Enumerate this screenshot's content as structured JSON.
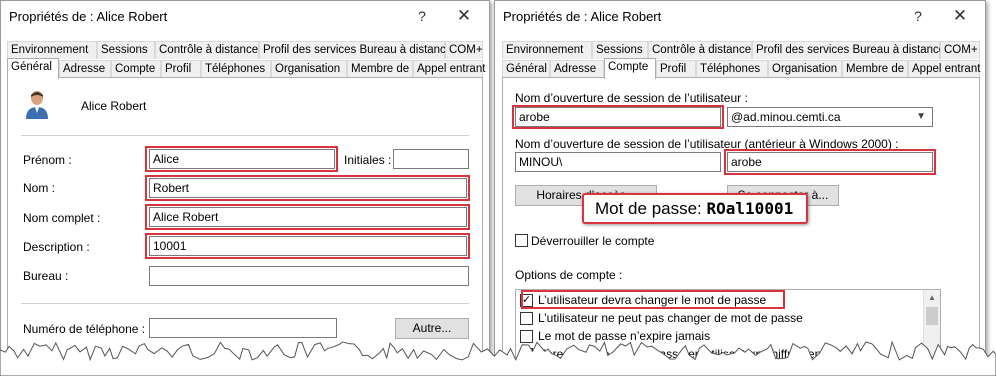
{
  "left_dialog": {
    "title": "Propriétés de : Alice Robert",
    "help_glyph": "?",
    "close_glyph": "✕",
    "tabs_row1": [
      "Environnement",
      "Sessions",
      "Contrôle à distance",
      "Profil des services Bureau à distance",
      "COM+"
    ],
    "tabs_row2": [
      "Général",
      "Adresse",
      "Compte",
      "Profil",
      "Téléphones",
      "Organisation",
      "Membre de",
      "Appel entrant"
    ],
    "active_tab": "Général",
    "display_name": "Alice Robert",
    "fields": {
      "prenom_label": "Prénom :",
      "prenom_value": "Alice",
      "initiales_label": "Initiales :",
      "initiales_value": "",
      "nom_label": "Nom :",
      "nom_value": "Robert",
      "nom_complet_label": "Nom complet :",
      "nom_complet_value": "Alice Robert",
      "description_label": "Description :",
      "description_value": "10001",
      "bureau_label": "Bureau :",
      "bureau_value": "",
      "telephone_label": "Numéro de téléphone :",
      "telephone_value": "",
      "autre_button": "Autre..."
    }
  },
  "right_dialog": {
    "title": "Propriétés de : Alice Robert",
    "help_glyph": "?",
    "close_glyph": "✕",
    "tabs_row1": [
      "Environnement",
      "Sessions",
      "Contrôle à distance",
      "Profil des services Bureau à distance",
      "COM+"
    ],
    "tabs_row2": [
      "Général",
      "Adresse",
      "Compte",
      "Profil",
      "Téléphones",
      "Organisation",
      "Membre de",
      "Appel entrant"
    ],
    "active_tab": "Compte",
    "logon_name_label": "Nom d’ouverture de session de l’utilisateur :",
    "logon_name_value": "arobe",
    "domain_value": "@ad.minou.cemti.ca",
    "pre2000_label": "Nom d’ouverture de session de l’utilisateur (antérieur à Windows 2000) :",
    "pre2000_domain": "MINOU\\",
    "pre2000_value": "arobe",
    "horaires_button": "Horaires d’accès...",
    "ouvrir_button": "Se connecter à...",
    "unlock_label": "Déverrouiller le compte",
    "options_label": "Options de compte :",
    "options": [
      {
        "label": "L’utilisateur devra changer le mot de passe",
        "checked": true
      },
      {
        "label": "L’utilisateur ne peut pas changer de mot de passe",
        "checked": false
      },
      {
        "label": "Le mot de passe n’expire jamais",
        "checked": false
      },
      {
        "label": "Enregistrer le mot de passe en utilisant un chiffrement réversible",
        "checked": false
      }
    ]
  },
  "callout": {
    "label": "Mot de passe:",
    "password": "ROal10001"
  },
  "colors": {
    "highlight": "#d9333f",
    "active_tab_bg": "#ffffff",
    "inactive_tab_bg": "#f0f0f0",
    "button_bg": "#e1e1e1"
  },
  "icons": {
    "user": "user-icon",
    "help": "help-icon",
    "close": "close-icon",
    "dropdown": "chevron-down-icon",
    "checkmark": "checkmark-icon"
  }
}
